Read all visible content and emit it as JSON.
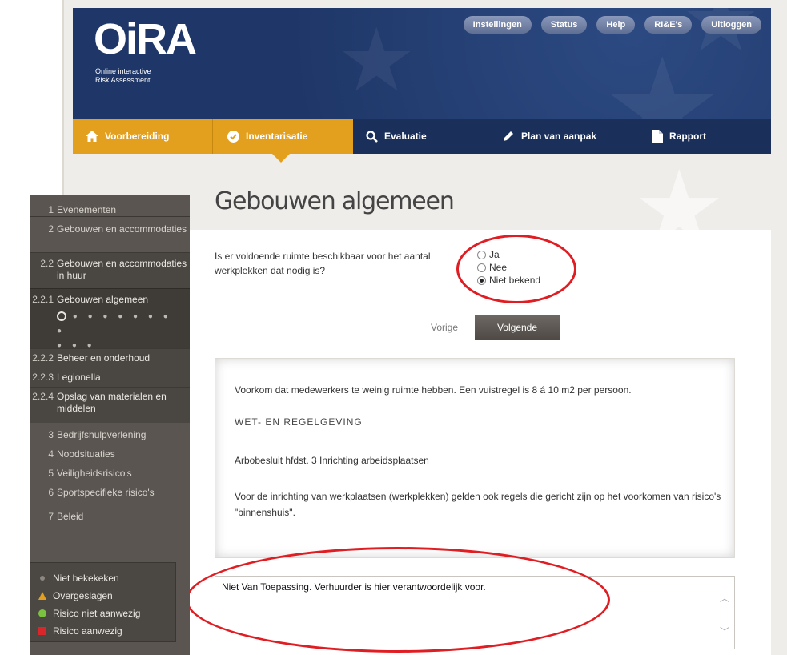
{
  "brand": {
    "logo": "OiRA",
    "subtitle_line1": "Online interactive",
    "subtitle_line2": "Risk Assessment"
  },
  "top_nav": [
    "Instellingen",
    "Status",
    "Help",
    "RI&E's",
    "Uitloggen"
  ],
  "tabs": [
    {
      "label": "Voorbereiding",
      "icon": "home-icon"
    },
    {
      "label": "Inventarisatie",
      "icon": "check-circle-icon"
    },
    {
      "label": "Evaluatie",
      "icon": "search-icon"
    },
    {
      "label": "Plan van aanpak",
      "icon": "pencil-icon"
    },
    {
      "label": "Rapport",
      "icon": "document-icon"
    }
  ],
  "active_tab": "Inventarisatie",
  "colors": {
    "accent": "#e3a01f",
    "header": "#1f3768",
    "annotation": "#e01d22"
  },
  "page": {
    "title": "Gebouwen algemeen",
    "question": "Is er voldoende ruimte beschikbaar voor het aantal werkplekken dat nodig is?",
    "options": [
      "Ja",
      "Nee",
      "Niet bekend"
    ],
    "selected_option": "Niet bekend",
    "prev_label": "Vorige",
    "next_label": "Volgende",
    "info": {
      "p1": "Voorkom dat medewerkers te weinig ruimte hebben. Een vuistregel is 8 á 10 m2 per persoon.",
      "heading": "Wet- en regelgeving",
      "p2": "Arbobesluit hfdst. 3 Inrichting arbeidsplaatsen",
      "p3": "Voor de inrichting van werkplaatsen (werkplekken) gelden ook regels die gericht zijn op het voorkomen van risico's \"binnenshuis\"."
    },
    "comment": "Niet Van Toepassing. Verhuurder is hier verantwoordelijk voor."
  },
  "sidebar": {
    "items": [
      {
        "num": "1",
        "label": "Evenementen"
      },
      {
        "num": "2",
        "label": "Gebouwen en accommodaties"
      },
      {
        "num": "2.2",
        "label": "Gebouwen en accommodaties in huur"
      },
      {
        "num": "2.2.1",
        "label": "Gebouwen algemeen"
      },
      {
        "num": "2.2.2",
        "label": "Beheer en onderhoud"
      },
      {
        "num": "2.2.3",
        "label": "Legionella"
      },
      {
        "num": "2.2.4",
        "label": "Opslag van materialen en middelen"
      },
      {
        "num": "3",
        "label": "Bedrijfshulpverlening"
      },
      {
        "num": "4",
        "label": "Noodsituaties"
      },
      {
        "num": "5",
        "label": "Veiligheidsrisico's"
      },
      {
        "num": "6",
        "label": "Sportspecifieke risico's"
      },
      {
        "num": "7",
        "label": "Beleid"
      }
    ],
    "legend": [
      {
        "label": "Niet bekekeken",
        "color": "#8c8780"
      },
      {
        "label": "Overgeslagen",
        "color": "#e3a01f"
      },
      {
        "label": "Risico niet aanwezig",
        "color": "#7cc241"
      },
      {
        "label": "Risico aanwezig",
        "color": "#d9262b"
      }
    ]
  }
}
